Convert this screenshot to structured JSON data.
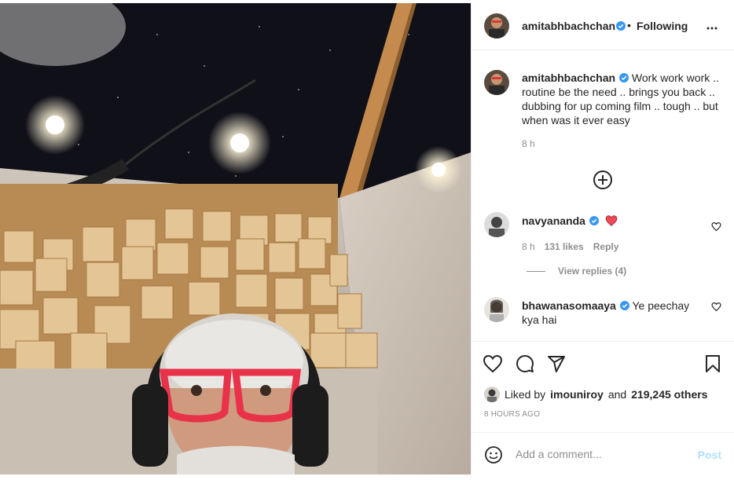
{
  "post": {
    "author": "amitabhbachchan",
    "follow_separator": "•",
    "follow_label": "Following",
    "more_icon": "more-options-icon",
    "caption_user": "amitabhbachchan",
    "caption_text": "Work work work .. routine be the need .. brings you back .. dubbing for up coming film .. tough .. but when was it ever easy",
    "caption_time": "8 h"
  },
  "comments": [
    {
      "user": "navyananda",
      "text": "",
      "emoji": "red-heart",
      "time": "8 h",
      "likes": "131 likes",
      "reply": "Reply",
      "view_replies": "View replies (4)"
    },
    {
      "user": "bhawanasomaaya",
      "text": "Ye peechay kya hai"
    }
  ],
  "actions": {
    "like_icon": "heart-outline-icon",
    "comment_icon": "comment-icon",
    "share_icon": "share-icon",
    "save_icon": "bookmark-icon"
  },
  "likes": {
    "prefix": "Liked by",
    "user": "imouniroy",
    "connector": "and",
    "count": "219,245 others"
  },
  "post_age": "8 HOURS AGO",
  "comment_box": {
    "placeholder": "Add a comment...",
    "post_label": "Post"
  },
  "colors": {
    "verified": "#3897f0",
    "heart": "#ed4956",
    "post_disabled": "#b2dffc",
    "muted": "#8e8e8e"
  }
}
